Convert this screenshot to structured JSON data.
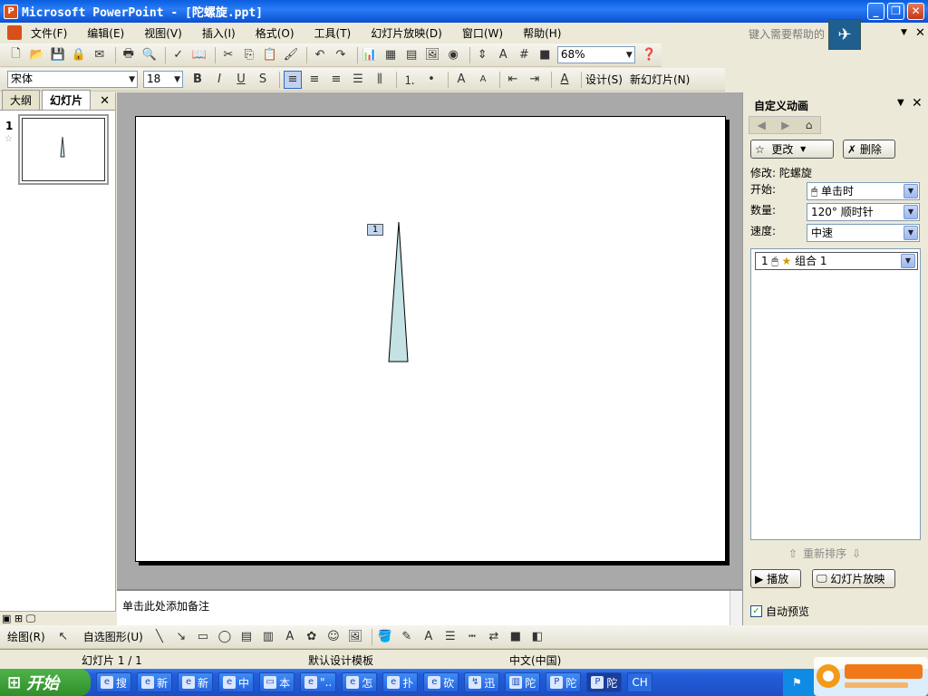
{
  "window": {
    "title": "Microsoft PowerPoint - [陀螺旋.ppt]"
  },
  "menu": [
    "文件(F)",
    "编辑(E)",
    "视图(V)",
    "插入(I)",
    "格式(O)",
    "工具(T)",
    "幻灯片放映(D)",
    "窗口(W)",
    "帮助(H)"
  ],
  "help_placeholder": "键入需要帮助的",
  "toolbar": {
    "zoom": "68%"
  },
  "format": {
    "font": "宋体",
    "size": "18",
    "design_label": "设计(S)",
    "new_slide_label": "新幻灯片(N)"
  },
  "left_tabs": {
    "outline": "大纲",
    "slides": "幻灯片"
  },
  "slide_number": "1",
  "anim_tag": "1",
  "notes_placeholder": "单击此处添加备注",
  "task_pane": {
    "title": "自定义动画",
    "change_label": "更改",
    "delete_label": "删除",
    "modify_label": "修改: 陀螺旋",
    "start_label": "开始:",
    "start_value": "单击时",
    "amount_label": "数量:",
    "amount_value": "120°  顺时针",
    "speed_label": "速度:",
    "speed_value": "中速",
    "item_label": "组合 1",
    "item_num": "1",
    "reorder_label": "重新排序",
    "play_label": "播放",
    "slideshow_label": "幻灯片放映",
    "autopreview_label": "自动预览"
  },
  "draw_toolbar": {
    "draw_label": "绘图(R)",
    "autoshape_label": "自选图形(U)"
  },
  "status": {
    "slide": "幻灯片 1 / 1",
    "template": "默认设计模板",
    "lang": "中文(中国)"
  },
  "taskbar": {
    "start": "开始",
    "tasks": [
      "搜",
      "新",
      "新",
      "中",
      "本",
      "\"..",
      "怎",
      "扑",
      "砍",
      "迅",
      "陀",
      "陀",
      "陀"
    ],
    "tray_lang": "CH"
  },
  "colors": {
    "shape_fill": "#c4e2e4",
    "title_blue": "#0a5fe0"
  }
}
